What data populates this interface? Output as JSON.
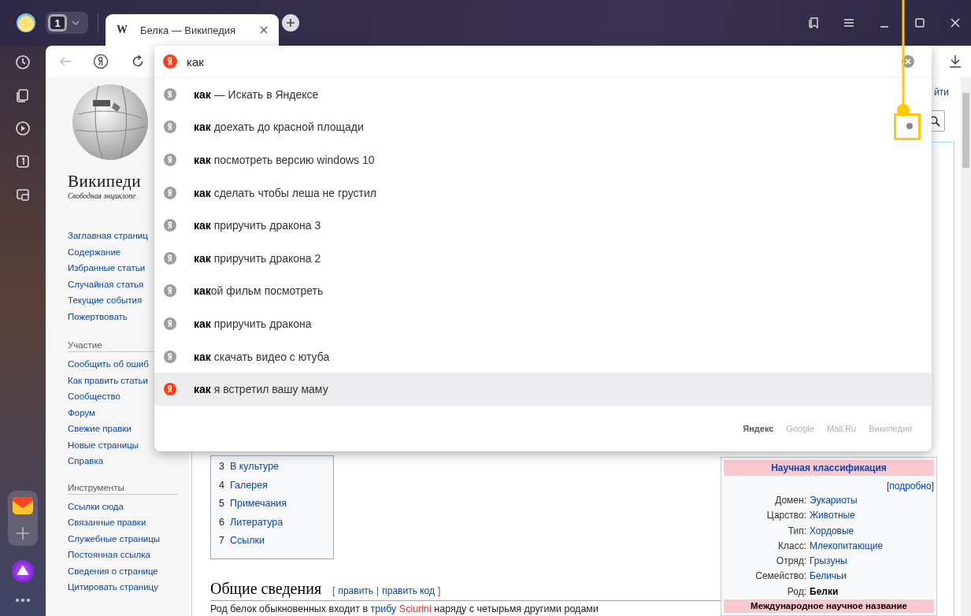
{
  "browser": {
    "tab_count": "1",
    "tabs": [
      {
        "favicon": "W",
        "title": "Белка — Википедия",
        "selected": true
      }
    ]
  },
  "address_bar": {
    "value": "как"
  },
  "suggestions": [
    {
      "text": "**как** — Искать в Яндексе",
      "selected": false
    },
    {
      "text": "**как** доехать до красной площади",
      "selected": false
    },
    {
      "text": "**как** посмотреть версию windows 10",
      "selected": false
    },
    {
      "text": "**как** сделать чтобы леша не грустил",
      "selected": false
    },
    {
      "text": "**как** приручить дракона 3",
      "selected": false
    },
    {
      "text": "**как** приручить дракона 2",
      "selected": false
    },
    {
      "text": "**как**ой фильм посмотреть",
      "selected": false
    },
    {
      "text": "**как** приручить дракона",
      "selected": false
    },
    {
      "text": "**как** скачать видео с ютуба",
      "selected": false
    },
    {
      "text": "**как** я встретил вашу маму",
      "selected": true
    }
  ],
  "search_engines": [
    {
      "label": "Яндекс",
      "selected": true
    },
    {
      "label": "Google",
      "selected": false
    },
    {
      "label": "Mail.Ru",
      "selected": false
    },
    {
      "label": "Википедия",
      "selected": false
    }
  ],
  "wiki": {
    "logo_title": "Википеди",
    "logo_subtitle": "Свободная энциклопе",
    "nav": [
      "Заглавная страниц",
      "Содержание",
      "Избранные статьи",
      "Случайная статья",
      "Текущие события",
      "Пожертвовать"
    ],
    "sections": [
      {
        "heading": "Участие",
        "links": [
          "Сообщить об ошиб",
          "Как править статьи",
          "Сообщество",
          "Форум",
          "Свежие правки",
          "Новые страницы",
          "Справка"
        ]
      },
      {
        "heading": "Инструменты",
        "links": [
          "Ссылки сюда",
          "Связанные правки",
          "Служебные страницы",
          "Постоянная ссылка",
          "Сведения о странице",
          "Цитировать страницу"
        ]
      }
    ],
    "login_link": "йти",
    "toc": [
      {
        "number": "3",
        "label": "В культуре"
      },
      {
        "number": "4",
        "label": "Галерея"
      },
      {
        "number": "5",
        "label": "Примечания"
      },
      {
        "number": "6",
        "label": "Литература"
      },
      {
        "number": "7",
        "label": "Ссылки"
      }
    ],
    "section_heading": "Общие сведения",
    "edit_links": {
      "open": "[",
      "links": [
        "править",
        "править код"
      ],
      "separator": "|",
      "close": "]"
    },
    "paragraph": [
      {
        "kind": "plain",
        "text": "Род белок обыкновенных входит в "
      },
      {
        "kind": "link",
        "text": "трибу"
      },
      {
        "kind": "redlink",
        "text": "Sciurini"
      },
      {
        "kind": "plain",
        "text": " наряду с четырьмя другими родами"
      }
    ],
    "infobox": {
      "header": "Научная классификация",
      "details": {
        "open": "[",
        "link": "подробно",
        "close": "]"
      },
      "rows": [
        {
          "label": "Домен:",
          "value": "Эукариоты",
          "kind": "link"
        },
        {
          "label": "Царство:",
          "value": "Животные",
          "kind": "link"
        },
        {
          "label": "Тип:",
          "value": "Хордовые",
          "kind": "link"
        },
        {
          "label": "Класс:",
          "value": "Млекопитающие",
          "kind": "link"
        },
        {
          "label": "Отряд:",
          "value": "Грызуны",
          "kind": "link"
        },
        {
          "label": "Семейство:",
          "value": "Беличьи",
          "kind": "link"
        },
        {
          "label": "Род:",
          "value": "Белки",
          "kind": "bold"
        }
      ],
      "footer_header": "Международное научное название"
    }
  }
}
